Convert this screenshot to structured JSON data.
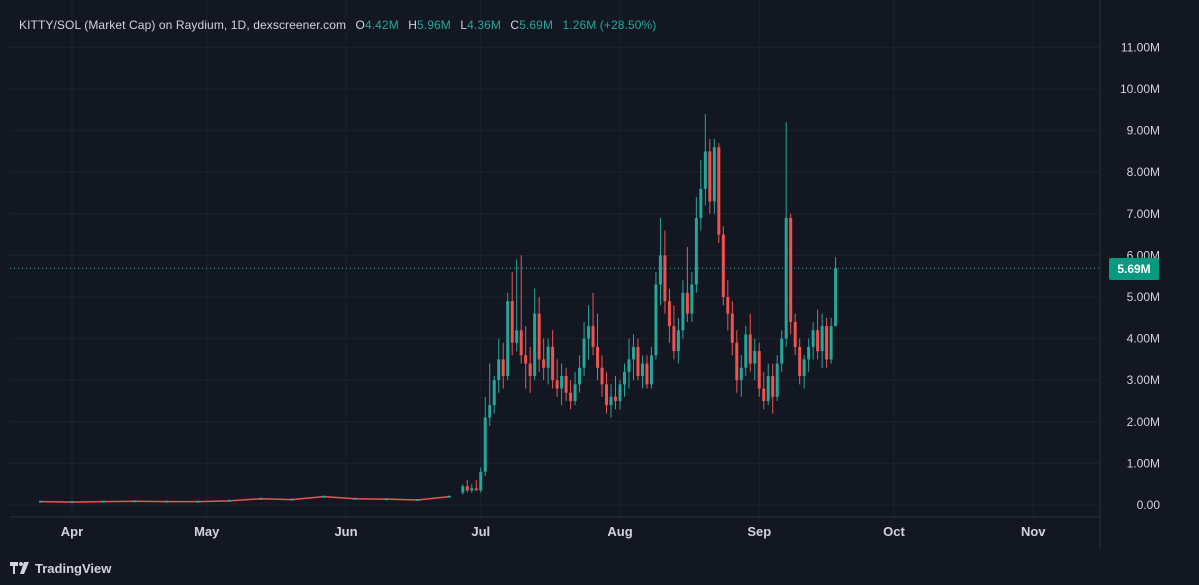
{
  "header": {
    "title": "KITTY/SOL (Market Cap) on Raydium, 1D, dexscreener.com",
    "open_label": "O",
    "open": "4.42M",
    "high_label": "H",
    "high": "5.96M",
    "low_label": "L",
    "low": "4.36M",
    "close_label": "C",
    "close": "5.69M",
    "change": "1.26M (+28.50%)"
  },
  "price_tag": "5.69M",
  "footer": {
    "brand": "TradingView",
    "logo_icon": "tradingview-logo-icon"
  },
  "colors": {
    "background": "#131722",
    "up": "#26a69a",
    "down": "#ef5350",
    "grid": "#1e222d",
    "text": "#d1d4dc",
    "price_tag": "#089981"
  },
  "chart_data": {
    "type": "candlestick",
    "interval": "1D",
    "ylim": [
      0,
      11.5
    ],
    "y_unit": "M",
    "y_ticks": [
      "0.00",
      "1.00M",
      "2.00M",
      "3.00M",
      "4.00M",
      "5.00M",
      "6.00M",
      "7.00M",
      "8.00M",
      "9.00M",
      "10.00M",
      "11.00M"
    ],
    "x_ticks": [
      "Apr",
      "May",
      "Jun",
      "Jul",
      "Aug",
      "Sep",
      "Oct",
      "Nov"
    ],
    "grid": true,
    "last_price": 5.69,
    "candles": [
      {
        "x": "Jun 27",
        "o": 0.3,
        "h": 0.5,
        "l": 0.25,
        "c": 0.45
      },
      {
        "x": "Jun 28",
        "o": 0.45,
        "h": 0.6,
        "l": 0.3,
        "c": 0.35
      },
      {
        "x": "Jun 29",
        "o": 0.35,
        "h": 0.5,
        "l": 0.3,
        "c": 0.4
      },
      {
        "x": "Jun 30",
        "o": 0.4,
        "h": 0.6,
        "l": 0.35,
        "c": 0.35
      },
      {
        "x": "Jul 1",
        "o": 0.35,
        "h": 0.9,
        "l": 0.3,
        "c": 0.8
      },
      {
        "x": "Jul 2",
        "o": 0.8,
        "h": 2.6,
        "l": 0.7,
        "c": 2.1
      },
      {
        "x": "Jul 3",
        "o": 2.1,
        "h": 3.4,
        "l": 1.9,
        "c": 2.4
      },
      {
        "x": "Jul 4",
        "o": 2.4,
        "h": 3.1,
        "l": 2.2,
        "c": 3.0
      },
      {
        "x": "Jul 5",
        "o": 3.0,
        "h": 4.0,
        "l": 2.7,
        "c": 3.5
      },
      {
        "x": "Jul 6",
        "o": 3.5,
        "h": 3.9,
        "l": 2.8,
        "c": 3.1
      },
      {
        "x": "Jul 7",
        "o": 3.1,
        "h": 5.1,
        "l": 3.0,
        "c": 4.9
      },
      {
        "x": "Jul 8",
        "o": 4.9,
        "h": 5.6,
        "l": 3.6,
        "c": 3.9
      },
      {
        "x": "Jul 9",
        "o": 3.9,
        "h": 5.9,
        "l": 3.7,
        "c": 4.2
      },
      {
        "x": "Jul 10",
        "o": 4.2,
        "h": 6.0,
        "l": 3.4,
        "c": 3.6
      },
      {
        "x": "Jul 11",
        "o": 3.6,
        "h": 4.3,
        "l": 2.8,
        "c": 3.4
      },
      {
        "x": "Jul 12",
        "o": 3.4,
        "h": 3.8,
        "l": 2.7,
        "c": 3.1
      },
      {
        "x": "Jul 13",
        "o": 3.1,
        "h": 5.2,
        "l": 3.0,
        "c": 4.6
      },
      {
        "x": "Jul 14",
        "o": 4.6,
        "h": 5.0,
        "l": 3.2,
        "c": 3.5
      },
      {
        "x": "Jul 15",
        "o": 3.5,
        "h": 4.0,
        "l": 3.0,
        "c": 3.3
      },
      {
        "x": "Jul 16",
        "o": 3.3,
        "h": 4.0,
        "l": 2.9,
        "c": 3.8
      },
      {
        "x": "Jul 17",
        "o": 3.8,
        "h": 4.2,
        "l": 2.8,
        "c": 3.0
      },
      {
        "x": "Jul 18",
        "o": 3.0,
        "h": 3.5,
        "l": 2.6,
        "c": 2.8
      },
      {
        "x": "Jul 19",
        "o": 2.8,
        "h": 3.4,
        "l": 2.4,
        "c": 3.1
      },
      {
        "x": "Jul 20",
        "o": 3.1,
        "h": 3.3,
        "l": 2.5,
        "c": 2.7
      },
      {
        "x": "Jul 21",
        "o": 2.7,
        "h": 3.0,
        "l": 2.3,
        "c": 2.5
      },
      {
        "x": "Jul 22",
        "o": 2.5,
        "h": 3.2,
        "l": 2.4,
        "c": 2.9
      },
      {
        "x": "Jul 23",
        "o": 2.9,
        "h": 3.6,
        "l": 2.7,
        "c": 3.3
      },
      {
        "x": "Jul 24",
        "o": 3.3,
        "h": 4.4,
        "l": 3.1,
        "c": 4.0
      },
      {
        "x": "Jul 25",
        "o": 4.0,
        "h": 4.8,
        "l": 3.5,
        "c": 4.3
      },
      {
        "x": "Jul 26",
        "o": 4.3,
        "h": 5.1,
        "l": 3.6,
        "c": 3.8
      },
      {
        "x": "Jul 27",
        "o": 3.8,
        "h": 4.6,
        "l": 3.0,
        "c": 3.3
      },
      {
        "x": "Jul 28",
        "o": 3.3,
        "h": 3.6,
        "l": 2.6,
        "c": 2.9
      },
      {
        "x": "Jul 29",
        "o": 2.9,
        "h": 3.2,
        "l": 2.2,
        "c": 2.4
      },
      {
        "x": "Jul 30",
        "o": 2.4,
        "h": 2.9,
        "l": 2.1,
        "c": 2.6
      },
      {
        "x": "Jul 31",
        "o": 2.6,
        "h": 3.1,
        "l": 2.3,
        "c": 2.5
      },
      {
        "x": "Aug 1",
        "o": 2.5,
        "h": 3.0,
        "l": 2.3,
        "c": 2.9
      },
      {
        "x": "Aug 2",
        "o": 2.9,
        "h": 3.4,
        "l": 2.6,
        "c": 3.2
      },
      {
        "x": "Aug 3",
        "o": 3.2,
        "h": 4.0,
        "l": 2.8,
        "c": 3.5
      },
      {
        "x": "Aug 4",
        "o": 3.5,
        "h": 4.1,
        "l": 3.0,
        "c": 3.8
      },
      {
        "x": "Aug 5",
        "o": 3.8,
        "h": 4.0,
        "l": 3.0,
        "c": 3.1
      },
      {
        "x": "Aug 6",
        "o": 3.1,
        "h": 3.6,
        "l": 2.8,
        "c": 3.4
      },
      {
        "x": "Aug 7",
        "o": 3.4,
        "h": 3.6,
        "l": 2.8,
        "c": 2.9
      },
      {
        "x": "Aug 8",
        "o": 2.9,
        "h": 3.8,
        "l": 2.8,
        "c": 3.6
      },
      {
        "x": "Aug 9",
        "o": 3.6,
        "h": 5.6,
        "l": 3.5,
        "c": 5.3
      },
      {
        "x": "Aug 10",
        "o": 5.3,
        "h": 6.9,
        "l": 4.8,
        "c": 6.0
      },
      {
        "x": "Aug 11",
        "o": 6.0,
        "h": 6.6,
        "l": 4.6,
        "c": 4.9
      },
      {
        "x": "Aug 12",
        "o": 4.9,
        "h": 5.2,
        "l": 3.9,
        "c": 4.3
      },
      {
        "x": "Aug 13",
        "o": 4.3,
        "h": 4.8,
        "l": 3.5,
        "c": 3.7
      },
      {
        "x": "Aug 14",
        "o": 3.7,
        "h": 4.5,
        "l": 3.4,
        "c": 4.2
      },
      {
        "x": "Aug 15",
        "o": 4.2,
        "h": 5.4,
        "l": 4.0,
        "c": 5.1
      },
      {
        "x": "Aug 16",
        "o": 5.1,
        "h": 6.2,
        "l": 4.4,
        "c": 4.6
      },
      {
        "x": "Aug 17",
        "o": 4.6,
        "h": 5.6,
        "l": 4.4,
        "c": 5.3
      },
      {
        "x": "Aug 18",
        "o": 5.3,
        "h": 7.4,
        "l": 5.1,
        "c": 6.9
      },
      {
        "x": "Aug 19",
        "o": 6.9,
        "h": 8.3,
        "l": 6.6,
        "c": 7.6
      },
      {
        "x": "Aug 20",
        "o": 7.6,
        "h": 9.4,
        "l": 7.2,
        "c": 8.5
      },
      {
        "x": "Aug 21",
        "o": 8.5,
        "h": 8.8,
        "l": 7.0,
        "c": 7.3
      },
      {
        "x": "Aug 22",
        "o": 7.3,
        "h": 8.8,
        "l": 7.0,
        "c": 8.6
      },
      {
        "x": "Aug 23",
        "o": 8.6,
        "h": 8.7,
        "l": 6.3,
        "c": 6.5
      },
      {
        "x": "Aug 24",
        "o": 6.5,
        "h": 6.7,
        "l": 4.8,
        "c": 5.0
      },
      {
        "x": "Aug 25",
        "o": 5.0,
        "h": 5.4,
        "l": 4.2,
        "c": 4.6
      },
      {
        "x": "Aug 26",
        "o": 4.6,
        "h": 4.9,
        "l": 3.6,
        "c": 3.9
      },
      {
        "x": "Aug 27",
        "o": 3.9,
        "h": 4.2,
        "l": 2.7,
        "c": 3.0
      },
      {
        "x": "Aug 28",
        "o": 3.0,
        "h": 3.6,
        "l": 2.6,
        "c": 3.3
      },
      {
        "x": "Aug 29",
        "o": 3.3,
        "h": 4.3,
        "l": 3.1,
        "c": 4.1
      },
      {
        "x": "Aug 30",
        "o": 4.1,
        "h": 4.6,
        "l": 3.2,
        "c": 3.4
      },
      {
        "x": "Aug 31",
        "o": 3.4,
        "h": 4.0,
        "l": 3.0,
        "c": 3.7
      },
      {
        "x": "Sep 1",
        "o": 3.7,
        "h": 3.9,
        "l": 2.6,
        "c": 2.8
      },
      {
        "x": "Sep 2",
        "o": 2.8,
        "h": 3.2,
        "l": 2.3,
        "c": 2.5
      },
      {
        "x": "Sep 3",
        "o": 2.5,
        "h": 3.4,
        "l": 2.4,
        "c": 3.1
      },
      {
        "x": "Sep 4",
        "o": 3.1,
        "h": 3.4,
        "l": 2.2,
        "c": 2.6
      },
      {
        "x": "Sep 5",
        "o": 2.6,
        "h": 3.6,
        "l": 2.5,
        "c": 3.4
      },
      {
        "x": "Sep 6",
        "o": 3.4,
        "h": 4.2,
        "l": 3.2,
        "c": 4.0
      },
      {
        "x": "Sep 7",
        "o": 4.0,
        "h": 9.2,
        "l": 3.8,
        "c": 6.9
      },
      {
        "x": "Sep 8",
        "o": 6.9,
        "h": 7.0,
        "l": 4.1,
        "c": 4.4
      },
      {
        "x": "Sep 9",
        "o": 4.4,
        "h": 4.6,
        "l": 3.6,
        "c": 3.8
      },
      {
        "x": "Sep 10",
        "o": 3.8,
        "h": 4.0,
        "l": 2.9,
        "c": 3.1
      },
      {
        "x": "Sep 11",
        "o": 3.1,
        "h": 3.6,
        "l": 2.8,
        "c": 3.5
      },
      {
        "x": "Sep 12",
        "o": 3.5,
        "h": 4.0,
        "l": 3.2,
        "c": 3.8
      },
      {
        "x": "Sep 13",
        "o": 3.8,
        "h": 4.4,
        "l": 3.5,
        "c": 4.2
      },
      {
        "x": "Sep 14",
        "o": 4.2,
        "h": 4.7,
        "l": 3.5,
        "c": 3.7
      },
      {
        "x": "Sep 15",
        "o": 3.7,
        "h": 4.6,
        "l": 3.3,
        "c": 4.3
      },
      {
        "x": "Sep 16",
        "o": 4.3,
        "h": 4.5,
        "l": 3.3,
        "c": 3.5
      },
      {
        "x": "Sep 17",
        "o": 3.5,
        "h": 4.5,
        "l": 3.4,
        "c": 4.3
      },
      {
        "x": "Sep 18",
        "o": 4.3,
        "h": 5.96,
        "l": 4.36,
        "c": 5.69
      }
    ],
    "early_series": [
      {
        "x": "Mar 25",
        "c": 0.08
      },
      {
        "x": "Apr 1",
        "c": 0.07
      },
      {
        "x": "Apr 8",
        "c": 0.08
      },
      {
        "x": "Apr 15",
        "c": 0.09
      },
      {
        "x": "Apr 22",
        "c": 0.08
      },
      {
        "x": "Apr 29",
        "c": 0.08
      },
      {
        "x": "May 6",
        "c": 0.1
      },
      {
        "x": "May 13",
        "c": 0.15
      },
      {
        "x": "May 20",
        "c": 0.13
      },
      {
        "x": "May 27",
        "c": 0.2
      },
      {
        "x": "Jun 3",
        "c": 0.15
      },
      {
        "x": "Jun 10",
        "c": 0.14
      },
      {
        "x": "Jun 17",
        "c": 0.12
      },
      {
        "x": "Jun 24",
        "c": 0.2
      }
    ]
  }
}
